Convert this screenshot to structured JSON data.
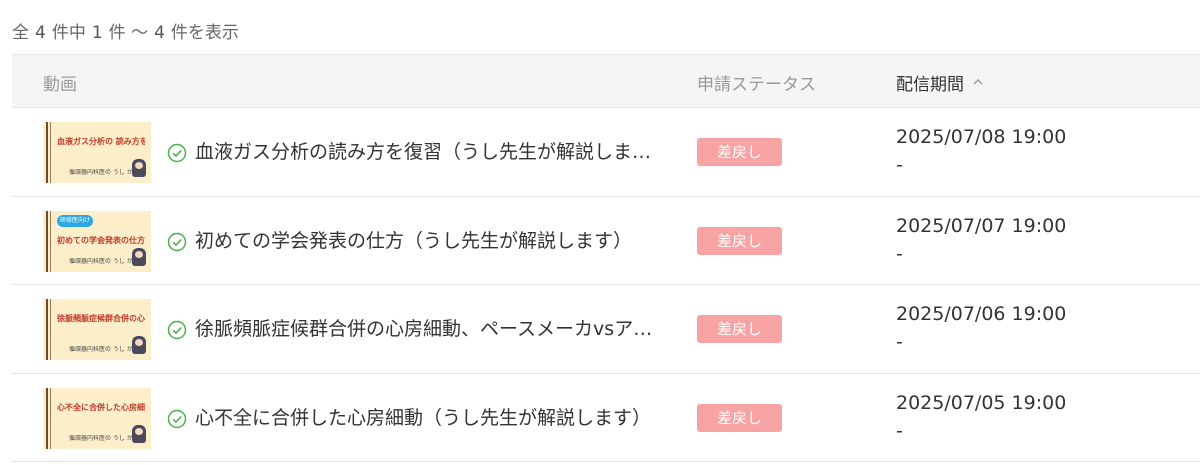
{
  "summary": {
    "prefix": "全",
    "total": "4",
    "middle": "件中",
    "from": "1",
    "range_sep": "件 ～",
    "to": "4",
    "suffix": "件を表示"
  },
  "table": {
    "headers": {
      "video": "動画",
      "status": "申請ステータス",
      "period": "配信期間"
    },
    "sort_icon": "chevron-up-icon",
    "rows": [
      {
        "title": "血液ガス分析の読み方を復習（うし先生が解説します）",
        "status": "差戻し",
        "date": "2025/07/08 19:00",
        "date_end": "-",
        "thumb_title": "血液ガス分析の 読み方を復習",
        "thumb_badge": "",
        "thumb_caption": "循環器内科医の うし が解説します"
      },
      {
        "title": "初めての学会発表の仕方（うし先生が解説します）",
        "status": "差戻し",
        "date": "2025/07/07 19:00",
        "date_end": "-",
        "thumb_title": "初めての学会発表の仕方",
        "thumb_badge": "研修医向け",
        "thumb_caption": "循環器内科医の うし が解説します"
      },
      {
        "title": "徐脈頻脈症候群合併の心房細動、ペースメーカvsア…",
        "status": "差戻し",
        "date": "2025/07/06 19:00",
        "date_end": "-",
        "thumb_title": "徐脈頻脈症候群合併の心房細動 ペースメーカvsアブレーション",
        "thumb_badge": "",
        "thumb_caption": "循環器内科医の うし が解説します"
      },
      {
        "title": "心不全に合併した心房細動（うし先生が解説します）",
        "status": "差戻し",
        "date": "2025/07/05 19:00",
        "date_end": "-",
        "thumb_title": "心不全に合併した心房細動 ベラパミルは本当にダメ?",
        "thumb_badge": "",
        "thumb_caption": "循環器内科医の うし が解説します"
      }
    ]
  },
  "colors": {
    "status_badge": "#f7a3a3",
    "check_icon": "#4caf50",
    "header_bg": "#f5f5f5",
    "thumb_bg": "#fbeec9"
  }
}
